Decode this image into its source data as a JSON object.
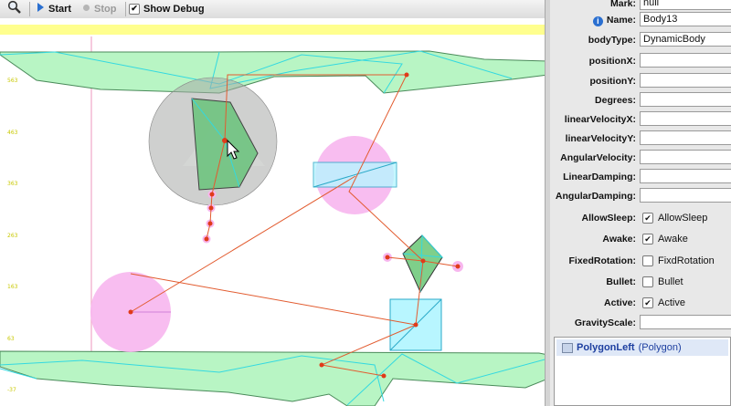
{
  "toolbar": {
    "start_label": "Start",
    "stop_label": "Stop",
    "debug_label": "Show Debug",
    "debug_checked": true
  },
  "canvas": {
    "y_axis_labels": [
      "563",
      "463",
      "363",
      "263",
      "163",
      "63",
      "-37"
    ]
  },
  "properties": {
    "mark": {
      "label": "Mark:",
      "value": "null"
    },
    "name": {
      "label": "Name:",
      "value": "Body13"
    },
    "body_type": {
      "label": "bodyType:",
      "value": "DynamicBody"
    },
    "position_x": {
      "label": "positionX:",
      "value": ""
    },
    "position_y": {
      "label": "positionY:",
      "value": ""
    },
    "degrees": {
      "label": "Degrees:",
      "value": ""
    },
    "linear_velocity_x": {
      "label": "linearVelocityX:",
      "value": ""
    },
    "linear_velocity_y": {
      "label": "linearVelocityY:",
      "value": ""
    },
    "angular_velocity": {
      "label": "AngularVelocity:",
      "value": ""
    },
    "linear_damping": {
      "label": "LinearDamping:",
      "value": ""
    },
    "angular_damping": {
      "label": "AngularDamping:",
      "value": ""
    },
    "allow_sleep": {
      "label": "AllowSleep:",
      "check_label": "AllowSleep",
      "checked": true
    },
    "awake": {
      "label": "Awake:",
      "check_label": "Awake",
      "checked": true
    },
    "fixed_rotation": {
      "label": "FixedRotation:",
      "check_label": "FixdRotation",
      "checked": false
    },
    "bullet": {
      "label": "Bullet:",
      "check_label": "Bullet",
      "checked": false
    },
    "active": {
      "label": "Active:",
      "check_label": "Active",
      "checked": true
    },
    "gravity_scale": {
      "label": "GravityScale:",
      "value": ""
    }
  },
  "fixtures": {
    "items": [
      {
        "name": "PolygonLeft",
        "type": "(Polygon)"
      }
    ]
  },
  "colors": {
    "static_fill": "#b8f5c4",
    "static_edge": "#33d9e0",
    "dynamic_fill": "#7fcf8a",
    "circle_pink": "#f7b6ee",
    "box_cyan": "#b8f6ff",
    "joint_line": "#e25b2f",
    "joint_dot": "#e03a1a"
  }
}
